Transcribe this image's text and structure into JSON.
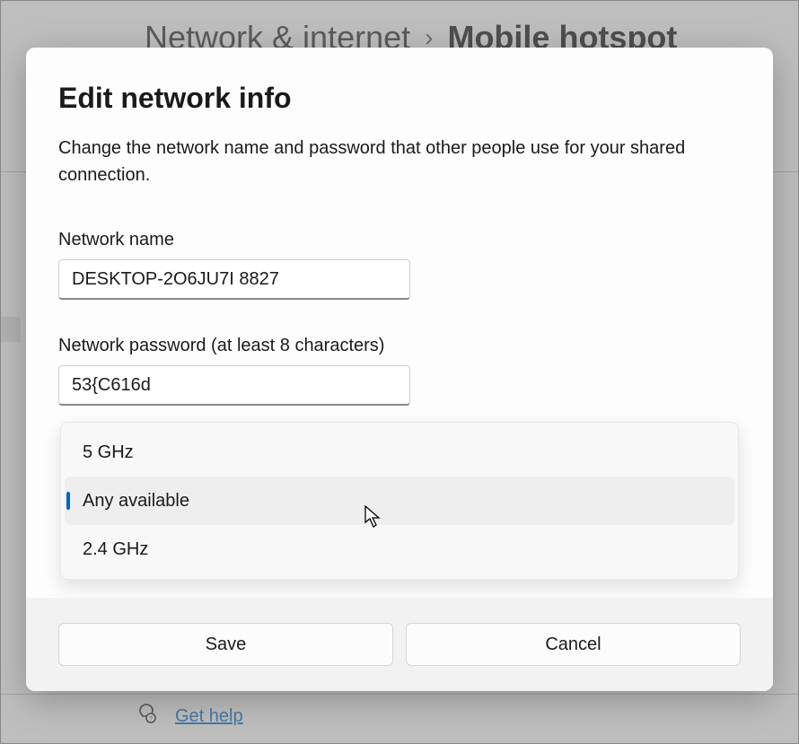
{
  "breadcrumb": {
    "parent": "Network & internet",
    "current": "Mobile hotspot"
  },
  "dialog": {
    "title": "Edit network info",
    "description": "Change the network name and password that other people use for your shared connection.",
    "network_name_label": "Network name",
    "network_name_value": "DESKTOP-2O6JU7I 8827",
    "password_label": "Network password (at least 8 characters)",
    "password_value": "53{C616d",
    "band_options": [
      "5 GHz",
      "Any available",
      "2.4 GHz"
    ],
    "band_selected": "Any available",
    "save_label": "Save",
    "cancel_label": "Cancel"
  },
  "help": {
    "label": "Get help"
  }
}
